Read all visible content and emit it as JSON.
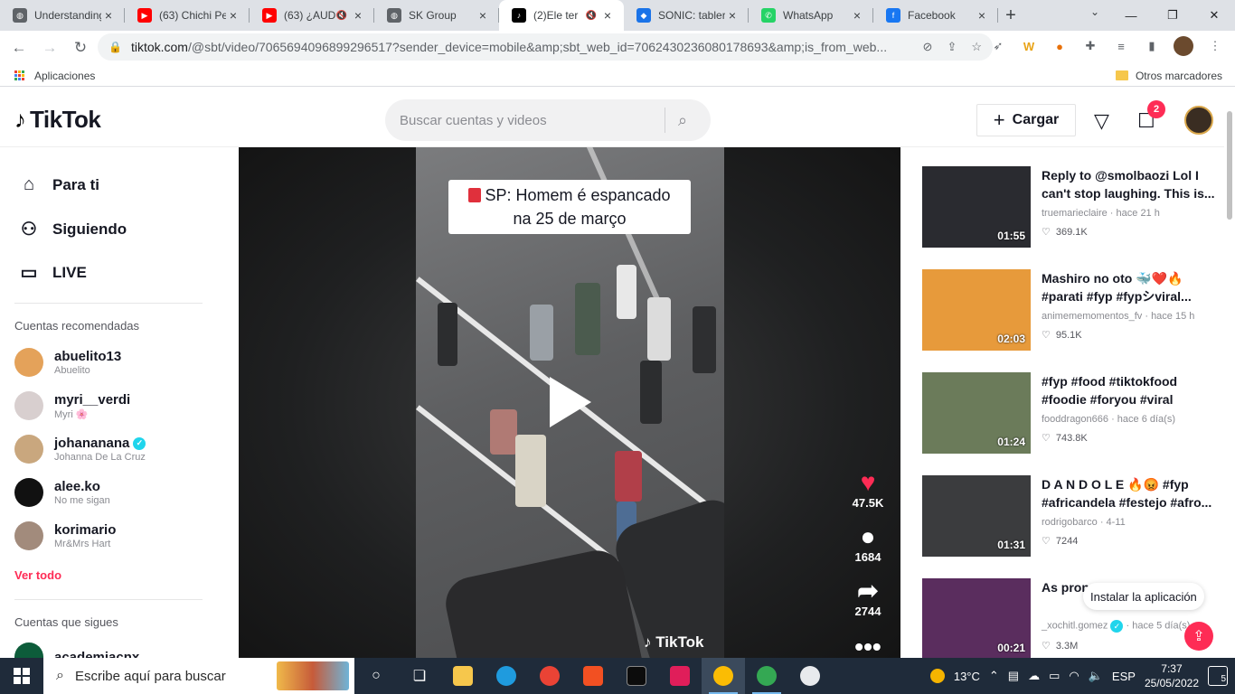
{
  "browser": {
    "tabs": [
      {
        "title": "Understanding",
        "favicon": "globe-icon",
        "color": "#5f6368",
        "active": false
      },
      {
        "title": "(63) Chichi Pe",
        "favicon": "youtube-icon",
        "color": "#ff0000",
        "active": false
      },
      {
        "title": "(63) ¿AUD",
        "favicon": "youtube-icon",
        "color": "#ff0000",
        "active": false,
        "muted": true
      },
      {
        "title": "SK Group",
        "favicon": "globe-icon",
        "color": "#5f6368",
        "active": false
      },
      {
        "title": "(2)Ele ter",
        "favicon": "tiktok-icon",
        "color": "#000000",
        "active": true,
        "muted": true
      },
      {
        "title": "SONIC: tabler",
        "favicon": "sonic-icon",
        "color": "#1a73e8",
        "active": false
      },
      {
        "title": "WhatsApp",
        "favicon": "whatsapp-icon",
        "color": "#25d366",
        "active": false
      },
      {
        "title": "Facebook",
        "favicon": "facebook-icon",
        "color": "#1877f2",
        "active": false
      }
    ],
    "url_host": "tiktok.com",
    "url_rest": "/@sbt/video/7065694096899296517?sender_device=mobile&amp;sbt_web_id=7062430236080178693&amp;is_from_web...",
    "bookmarks_apps": "Aplicaciones",
    "bookmarks_other": "Otros marcadores"
  },
  "tiktok": {
    "logo": "TikTok",
    "search_placeholder": "Buscar cuentas y videos",
    "upload_label": "Cargar",
    "message_badge": "2",
    "nav": [
      {
        "label": "Para ti",
        "icon": "home-icon"
      },
      {
        "label": "Siguiendo",
        "icon": "following-icon"
      },
      {
        "label": "LIVE",
        "icon": "live-icon"
      }
    ],
    "recommended_title": "Cuentas recomendadas",
    "recommended": [
      {
        "username": "abuelito13",
        "display": "Abuelito",
        "color": "#e4a25a",
        "verified": false
      },
      {
        "username": "myri__verdi",
        "display": "Myri 🌸",
        "color": "#d8cfcf",
        "verified": false
      },
      {
        "username": "johananana",
        "display": "Johanna De La Cruz",
        "color": "#c9a77e",
        "verified": true
      },
      {
        "username": "alee.ko",
        "display": "No me sigan",
        "color": "#111111",
        "verified": false
      },
      {
        "username": "korimario",
        "display": "Mr&Mrs Hart",
        "color": "#a28b7c",
        "verified": false
      }
    ],
    "see_all": "Ver todo",
    "following_title": "Cuentas que sigues",
    "following_first": "academiacnx",
    "video": {
      "caption_line1": "SP: Homem é espancado",
      "caption_line2": "na 25 de março",
      "watermark": "TikTok",
      "likes": "47.5K",
      "comments": "1684",
      "shares": "2744"
    },
    "related": [
      {
        "title": "Reply to @smolbaozi Lol I can't stop laughing. This is...",
        "author": "truemarieclaire",
        "time": "hace 21 h",
        "likes": "369.1K",
        "duration": "01:55",
        "thumb": "#2a2b30"
      },
      {
        "title": "Mashiro no oto 🐳❤️🔥 #parati #fyp #fypシviral...",
        "author": "animememomentos_fv",
        "time": "hace 15 h",
        "likes": "95.1K",
        "duration": "02:03",
        "thumb": "#e79a3b"
      },
      {
        "title": "#fyp #food #tiktokfood #foodie #foryou #viral",
        "author": "fooddragon666",
        "time": "hace 6 día(s)",
        "likes": "743.8K",
        "duration": "01:24",
        "thumb": "#6b7b5a"
      },
      {
        "title": "D A N D O L E 🔥😡 #fyp #africandela #festejo #afro...",
        "author": "rodrigobarco",
        "time": "4-11",
        "likes": "7244",
        "duration": "01:31",
        "thumb": "#3b3c3e"
      },
      {
        "title": "As pron... #docto...",
        "author": "_xochitl.gomez",
        "time": "hace 5 día(s)",
        "likes": "3.3M",
        "duration": "00:21",
        "thumb": "#5a2d5e",
        "verified": true
      }
    ],
    "install_app": "Instalar la aplicación"
  },
  "taskbar": {
    "search_placeholder": "Escribe aquí para buscar",
    "weather": "13°C",
    "language": "ESP",
    "time": "7:37",
    "date": "25/05/2022",
    "notifications": "5"
  }
}
